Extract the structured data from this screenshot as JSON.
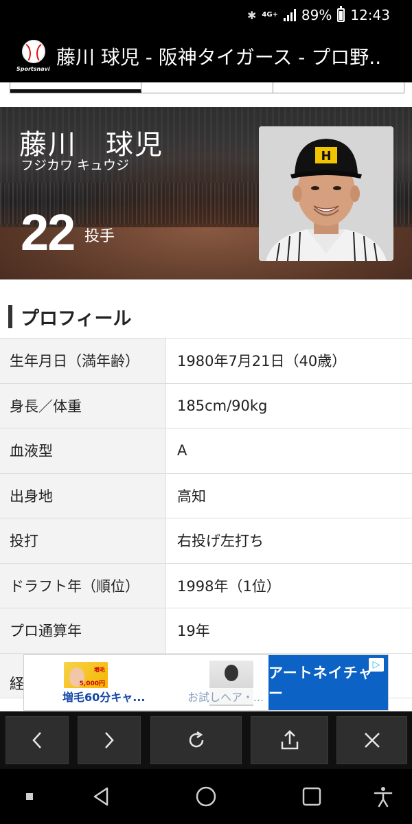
{
  "status_bar": {
    "network": "4G+",
    "battery": "89%",
    "time": "12:43"
  },
  "browser": {
    "site_logo": "Sportsnavi",
    "page_title": "藤川 球児 - 阪神タイガース - プロ野.."
  },
  "player": {
    "name": "藤川　球児",
    "name_kana": "フジカワ キュウジ",
    "number": "22",
    "position": "投手"
  },
  "profile": {
    "heading": "プロフィール",
    "rows": [
      {
        "label": "生年月日（満年齢）",
        "value": "1980年7月21日（40歳）"
      },
      {
        "label": "身長／体重",
        "value": "185cm/90kg"
      },
      {
        "label": "血液型",
        "value": "A"
      },
      {
        "label": "出身地",
        "value": "高知"
      },
      {
        "label": "投打",
        "value": "右投げ左打ち"
      },
      {
        "label": "ドラフト年（順位）",
        "value": "1998年（1位）"
      },
      {
        "label": "プロ通算年",
        "value": "19年"
      },
      {
        "label": "経",
        "value": ""
      }
    ]
  },
  "ad": {
    "item1_label": "増毛60分キャ...",
    "item1_thumb_title": "増毛",
    "item1_thumb_price": "5,000円",
    "item2_label": "お試しヘア・...",
    "brand": "アートネイチャー",
    "adchoices": "▷"
  },
  "colors": {
    "title_bar": "#000000",
    "ad_brand_bg": "#0d62c6",
    "table_key_bg": "#f3f3f3"
  }
}
